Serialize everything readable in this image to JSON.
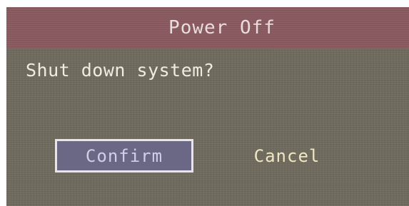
{
  "dialog": {
    "title": "Power Off",
    "message": "Shut down system?",
    "confirm_label": "Confirm",
    "cancel_label": "Cancel",
    "selected_button": "Confirm"
  },
  "colors": {
    "title_bar": "#8a5a60",
    "dialog_background": "#6f6a5d",
    "selected_button_fill": "#6b6886",
    "cancel_text": "#efe7c2"
  }
}
